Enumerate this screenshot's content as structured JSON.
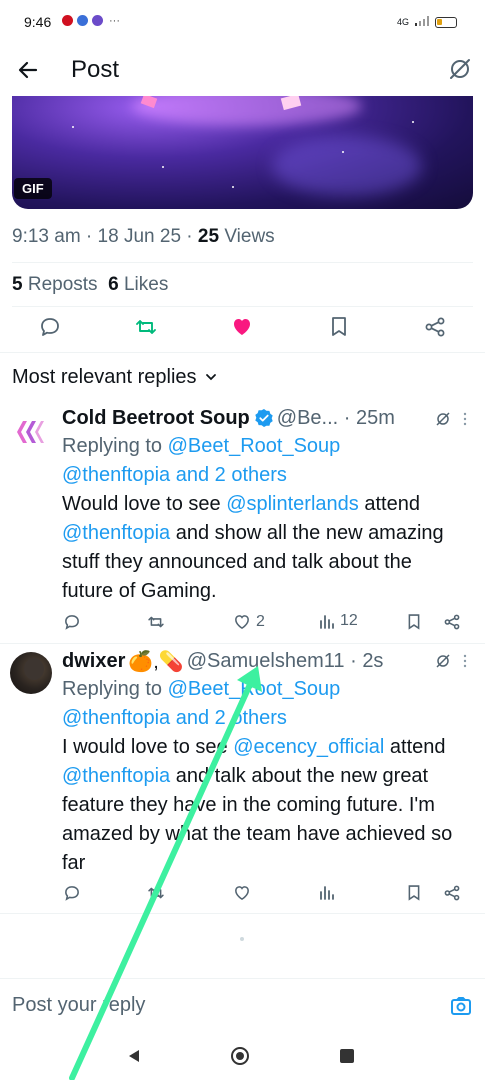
{
  "status": {
    "time": "9:46",
    "signal": "4G",
    "more": "···"
  },
  "header": {
    "title": "Post"
  },
  "media": {
    "badge": "GIF"
  },
  "post": {
    "time": "9:13 am",
    "date": "18 Jun 25",
    "views_count": "25",
    "views_label": "Views",
    "reposts_count": "5",
    "reposts_label": "Reposts",
    "likes_count": "6",
    "likes_label": "Likes"
  },
  "replies_header": {
    "label": "Most relevant replies"
  },
  "replies": [
    {
      "name": "Cold Beetroot Soup",
      "handle": "@Be...",
      "time": "25m",
      "replying_to": "Replying to",
      "mention1": "@Beet_Root_Soup",
      "mention2": "@thenftopia",
      "and_others": "and 2 others",
      "text_1": "Would love to see",
      "link_1": "@splinterlands",
      "text_2": "attend",
      "link_2": "@thenftopia",
      "text_3": "and show all the new amazing stuff they announced and talk about the future of Gaming.",
      "likes": "2",
      "views": "12"
    },
    {
      "name": "dwixer",
      "name_suffix": "🍊,💊",
      "handle": "@Samuelshem11",
      "time": "2s",
      "replying_to": "Replying to",
      "mention1": "@Beet_Root_Soup",
      "mention2": "@thenftopia",
      "and_others": "and 2 others",
      "text_1": "I would love to see",
      "link_1": "@ecency_official",
      "text_2": "attend",
      "link_2": "@thenftopia",
      "text_3": " and talk about the new great feature they have in the coming future. I'm amazed by what the team have achieved so far"
    }
  ],
  "composer": {
    "placeholder": "Post your reply"
  },
  "colors": {
    "accent": "#1d9bf0",
    "like": "#f91880",
    "repost": "#00ba7c",
    "annotation_arrow": "#3df0a0"
  }
}
